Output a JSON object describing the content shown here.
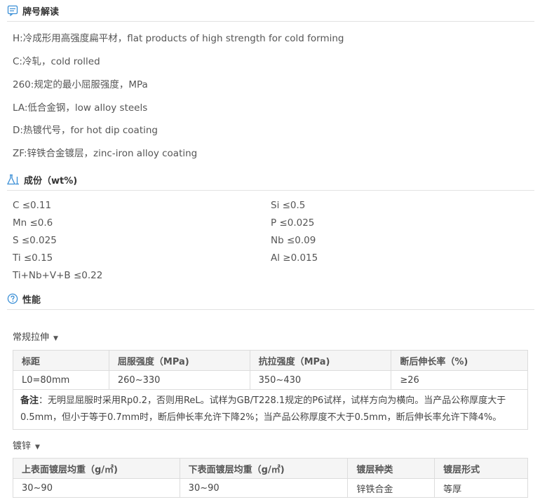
{
  "designation": {
    "title": "牌号解读",
    "lines": [
      "H:冷成形用高强度扁平材，flat products of high strength for cold forming",
      "C:冷轧，cold rolled",
      "260:规定的最小屈服强度，MPa",
      "LA:低合金钢，low alloy steels",
      "D:热镀代号，for hot dip coating",
      "ZF:锌铁合金镀层，zinc-iron alloy coating"
    ]
  },
  "composition": {
    "title": "成份（wt%)",
    "left": [
      "C ≤0.11",
      "Mn ≤0.6",
      "S ≤0.025",
      "Ti ≤0.15",
      "Ti+Nb+V+B ≤0.22"
    ],
    "right": [
      "Si ≤0.5",
      "P ≤0.025",
      "Nb ≤0.09",
      "Al ≥0.015"
    ]
  },
  "properties": {
    "title": "性能",
    "tensile": {
      "label": "常规拉伸",
      "headers": [
        "标距",
        "屈服强度（MPa)",
        "抗拉强度（MPa)",
        "断后伸长率（%)"
      ],
      "row": [
        "L0=80mm",
        "260~330",
        "350~430",
        "≥26"
      ],
      "note_label": "备注",
      "note_text": "：无明显屈服时采用Rp0.2，否则用ReL。试样为GB/T228.1规定的P6试样，试样方向为横向。当产品公称厚度大于0.5mm，但小于等于0.7mm时，断后伸长率允许下降2%；当产品公称厚度不大于0.5mm，断后伸长率允许下降4%。"
    },
    "coating": {
      "label": "镀锌",
      "headers": [
        "上表面镀层均重（g/㎡)",
        "下表面镀层均重（g/㎡)",
        "镀层种类",
        "镀层形式"
      ],
      "row": [
        "30~90",
        "30~90",
        "锌铁合金",
        "等厚"
      ]
    }
  },
  "colors": {
    "icon_blue": "#3b8fd6",
    "header_bg": "#f5f5f5",
    "border": "#dcdcdc"
  }
}
